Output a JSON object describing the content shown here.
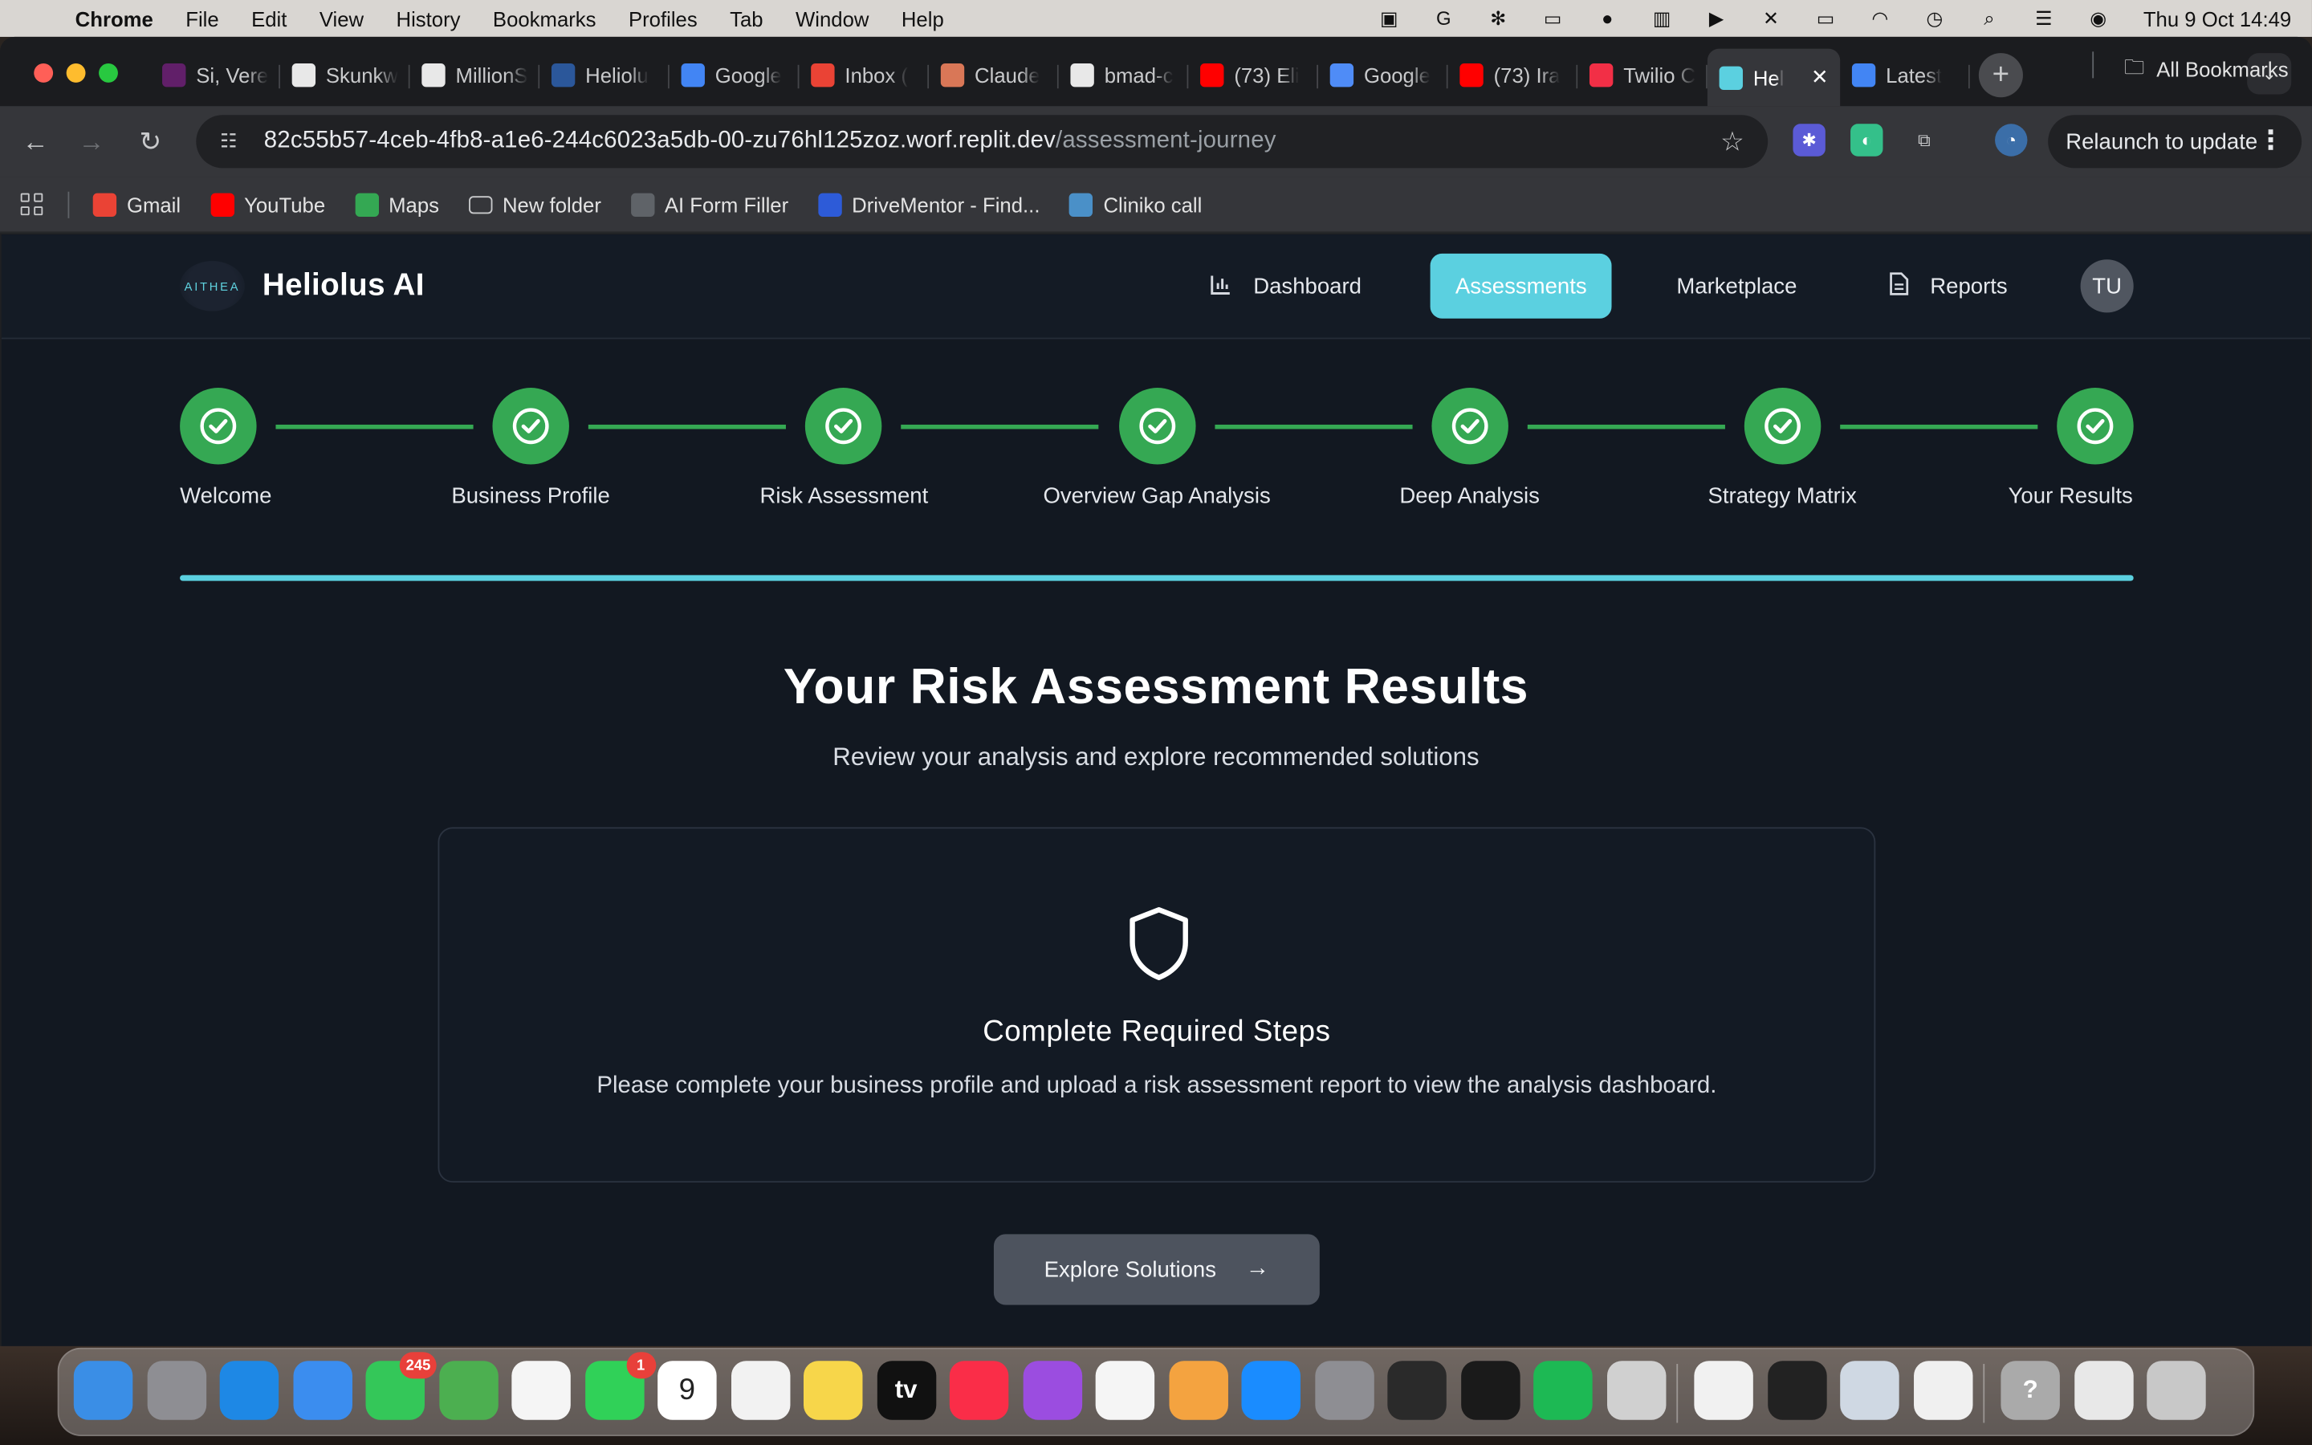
{
  "menubar": {
    "app": "Chrome",
    "items": [
      "File",
      "Edit",
      "View",
      "History",
      "Bookmarks",
      "Profiles",
      "Tab",
      "Window",
      "Help"
    ],
    "clock": "Thu 9 Oct  14:49"
  },
  "tabs": [
    {
      "title": "Si, Vere",
      "icon": "slack-icon",
      "color": "#611f69"
    },
    {
      "title": "Skunkw",
      "icon": "app-icon",
      "color": "#ffffff"
    },
    {
      "title": "MillionS",
      "icon": "app-icon",
      "color": "#ffffff"
    },
    {
      "title": "Heliolu",
      "icon": "word-icon",
      "color": "#2b579a"
    },
    {
      "title": "Google",
      "icon": "docs-icon",
      "color": "#4285f4"
    },
    {
      "title": "Inbox (",
      "icon": "gmail-icon",
      "color": "#ea4335"
    },
    {
      "title": "Claude",
      "icon": "claude-icon",
      "color": "#d97757"
    },
    {
      "title": "bmad-c",
      "icon": "github-icon",
      "color": "#ffffff"
    },
    {
      "title": "(73) Eli",
      "icon": "youtube-icon",
      "color": "#ff0000"
    },
    {
      "title": "Google",
      "icon": "gemini-icon",
      "color": "#4f8cf7"
    },
    {
      "title": "(73) Ira",
      "icon": "youtube-icon",
      "color": "#ff0000"
    },
    {
      "title": "Twilio C",
      "icon": "twilio-icon",
      "color": "#f22f46"
    },
    {
      "title": "Hel",
      "icon": "replit-icon",
      "color": "#5bd0e0",
      "active": true
    },
    {
      "title": "Latest",
      "icon": "google-icon",
      "color": "#4285f4"
    }
  ],
  "omnibox": {
    "host": "82c55b57-4ceb-4fb8-a1e6-244c6023a5db-00-zu76hl125zoz.worf.replit.dev",
    "path": "/assessment-journey"
  },
  "relaunch_label": "Relaunch to update",
  "bookmarks": [
    {
      "label": "Gmail",
      "icon": "gmail-icon"
    },
    {
      "label": "YouTube",
      "icon": "youtube-icon"
    },
    {
      "label": "Maps",
      "icon": "maps-icon"
    },
    {
      "label": "New folder",
      "icon": "folder-icon"
    },
    {
      "label": "AI Form Filler",
      "icon": "globe-icon"
    },
    {
      "label": "DriveMentor - Find...",
      "icon": "drivementor-icon"
    },
    {
      "label": "Cliniko call",
      "icon": "cliniko-icon"
    }
  ],
  "all_bookmarks": "All Bookmarks",
  "app": {
    "logo_text": "AITHEA",
    "brand": "Heliolus AI",
    "nav": [
      {
        "label": "Dashboard",
        "icon": "bar-chart-icon"
      },
      {
        "label": "Assessments",
        "active": true
      },
      {
        "label": "Marketplace"
      },
      {
        "label": "Reports",
        "icon": "document-icon"
      }
    ],
    "avatar": "TU"
  },
  "steps": [
    {
      "label": "Welcome",
      "status": "complete"
    },
    {
      "label": "Business Profile",
      "status": "complete"
    },
    {
      "label": "Risk Assessment",
      "status": "complete"
    },
    {
      "label": "Overview Gap Analysis",
      "status": "complete"
    },
    {
      "label": "Deep Analysis",
      "status": "complete"
    },
    {
      "label": "Strategy Matrix",
      "status": "complete"
    },
    {
      "label": "Your Results",
      "status": "complete"
    }
  ],
  "progress": 1.0,
  "results": {
    "title": "Your Risk Assessment Results",
    "subtitle": "Review your analysis and explore recommended solutions",
    "card_title": "Complete Required Steps",
    "card_text": "Please complete your business profile and upload a risk assessment report to view the analysis dashboard.",
    "cta": "Explore Solutions"
  },
  "dock": {
    "apps": [
      {
        "name": "finder-icon",
        "color": "#3a8ee6"
      },
      {
        "name": "launchpad-icon",
        "color": "#8e8e93"
      },
      {
        "name": "safari-icon",
        "color": "#1e88e5"
      },
      {
        "name": "mail-icon",
        "color": "#3b8def"
      },
      {
        "name": "messages-icon",
        "color": "#34c759",
        "badge": "245"
      },
      {
        "name": "maps-icon",
        "color": "#4caf50"
      },
      {
        "name": "photos-icon",
        "color": "#f5f5f5"
      },
      {
        "name": "facetime-icon",
        "color": "#30d158",
        "badge": "1"
      },
      {
        "name": "calendar-icon",
        "color": "#ffffff",
        "text": "9"
      },
      {
        "name": "reminders-icon",
        "color": "#f2f2f2"
      },
      {
        "name": "notes-icon",
        "color": "#f7d64a"
      },
      {
        "name": "apple-tv-icon",
        "color": "#111111",
        "text": "tv"
      },
      {
        "name": "music-icon",
        "color": "#fa2d48"
      },
      {
        "name": "podcasts-icon",
        "color": "#9b4de0"
      },
      {
        "name": "news-icon",
        "color": "#f5f5f5"
      },
      {
        "name": "pages-icon",
        "color": "#f4a340"
      },
      {
        "name": "app-store-icon",
        "color": "#1a8cff"
      },
      {
        "name": "system-settings-icon",
        "color": "#8e8e93"
      },
      {
        "name": "musescore-icon",
        "color": "#2a2a2a"
      },
      {
        "name": "shortcuts-app-icon",
        "color": "#1a1a1a"
      },
      {
        "name": "spotify-icon",
        "color": "#1db954"
      },
      {
        "name": "iphone-mirroring-icon",
        "color": "#d0d0d0"
      },
      {
        "name": "chrome-icon",
        "color": "#f1f1f1"
      },
      {
        "name": "figma-like-icon",
        "color": "#222222"
      },
      {
        "name": "preview-icon",
        "color": "#cfd8e3"
      },
      {
        "name": "textedit-icon",
        "color": "#f0f0f0"
      },
      {
        "name": "help-icon",
        "color": "#aaaaaa",
        "text": "?"
      },
      {
        "name": "documents-icon",
        "color": "#e8e8e8"
      },
      {
        "name": "trash-icon",
        "color": "#c8c8c8"
      }
    ]
  },
  "colors": {
    "accent": "#5bd0e0",
    "success": "#35a853",
    "page_bg": "#121821"
  }
}
